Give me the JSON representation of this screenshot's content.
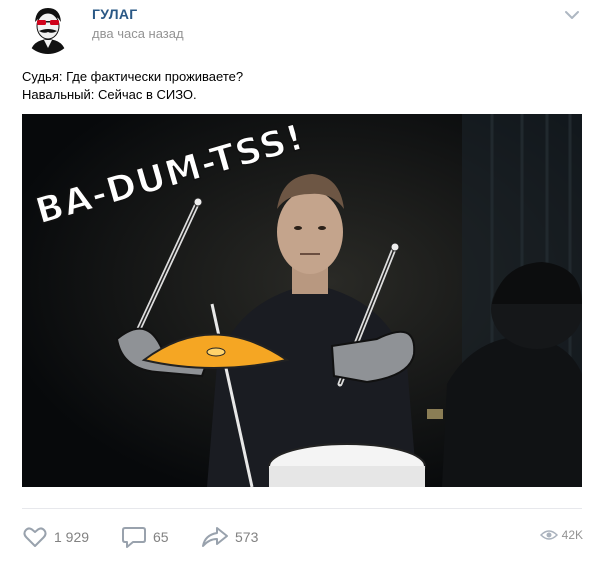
{
  "post": {
    "author": "ГУЛАГ",
    "time": "два часа назад",
    "text_lines": [
      "Судья: Где фактически проживаете?",
      "Навальный: Сейчас в СИЗО."
    ],
    "image_caption": "BA-DUM-TSS!"
  },
  "actions": {
    "likes": "1 929",
    "comments": "65",
    "shares": "573",
    "views": "42K"
  },
  "icons": {
    "menu": "chevron-down-icon",
    "like": "heart-icon",
    "comment": "comment-icon",
    "share": "share-arrow-icon",
    "views": "eye-icon"
  },
  "colors": {
    "author_link": "#2a5885",
    "muted": "#939393",
    "action": "#828282",
    "cymbal": "#f5a623",
    "image_bg": "#0b0d0f"
  }
}
